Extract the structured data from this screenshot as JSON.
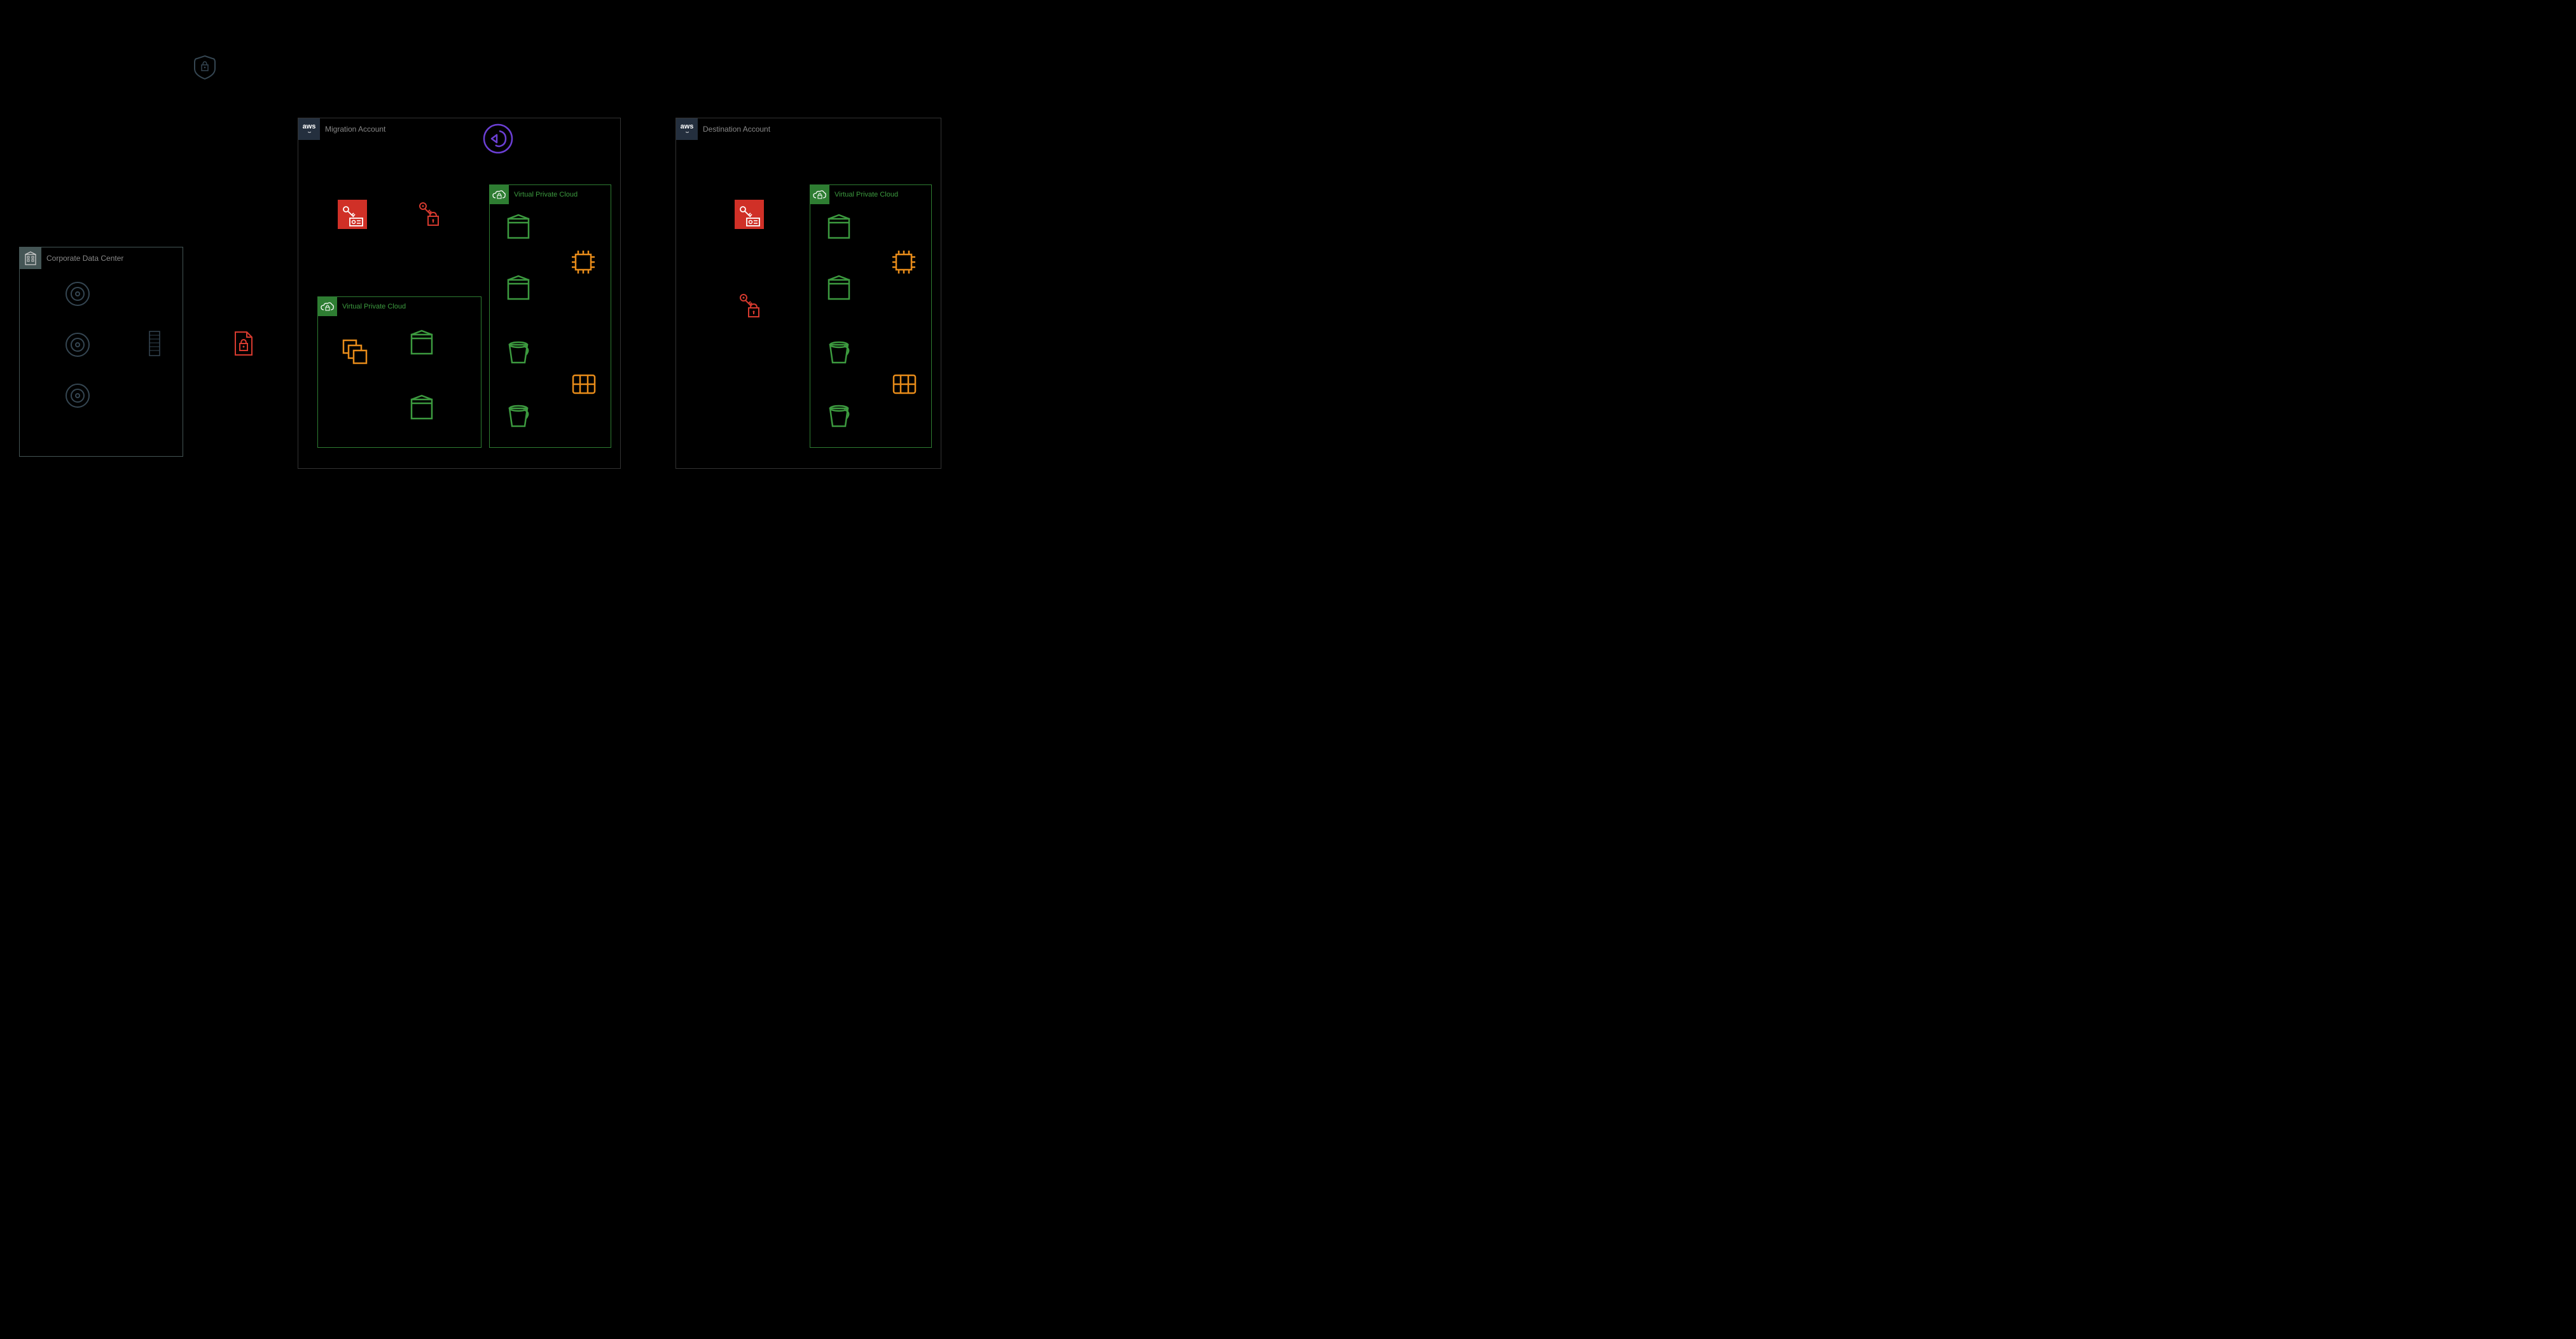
{
  "corporate": {
    "title": "Corporate Data Center"
  },
  "accounts": {
    "migration": {
      "title": "Migration Account",
      "vendor": "aws"
    },
    "destination": {
      "title": "Destination Account",
      "vendor": "aws"
    }
  },
  "vpc": {
    "migration_left": {
      "title": "Virtual Private Cloud"
    },
    "migration_right": {
      "title": "Virtual Private Cloud"
    },
    "destination": {
      "title": "Virtual Private Cloud"
    }
  },
  "icons": {
    "shield_badge": "shield-badge-icon",
    "encrypted_file": "encrypted-file-icon",
    "credentials": "credentials-icon",
    "key_lock": "key-lock-icon",
    "migration_service": "migration-service-icon",
    "disk": "disk-icon",
    "server_rack": "server-rack-icon",
    "stacked_copies": "stacked-copies-icon",
    "box_container": "box-container-icon",
    "bucket": "bucket-icon",
    "chip": "chip-icon",
    "grid_table": "grid-table-icon",
    "cloud_lock": "cloud-lock-icon",
    "building": "building-icon"
  },
  "colors": {
    "red": "#d63a2f",
    "green": "#3c9a3f",
    "orange": "#e88c1a",
    "purple": "#6b3fd4",
    "slate": "#455",
    "dark_blue": "#242f3e"
  }
}
